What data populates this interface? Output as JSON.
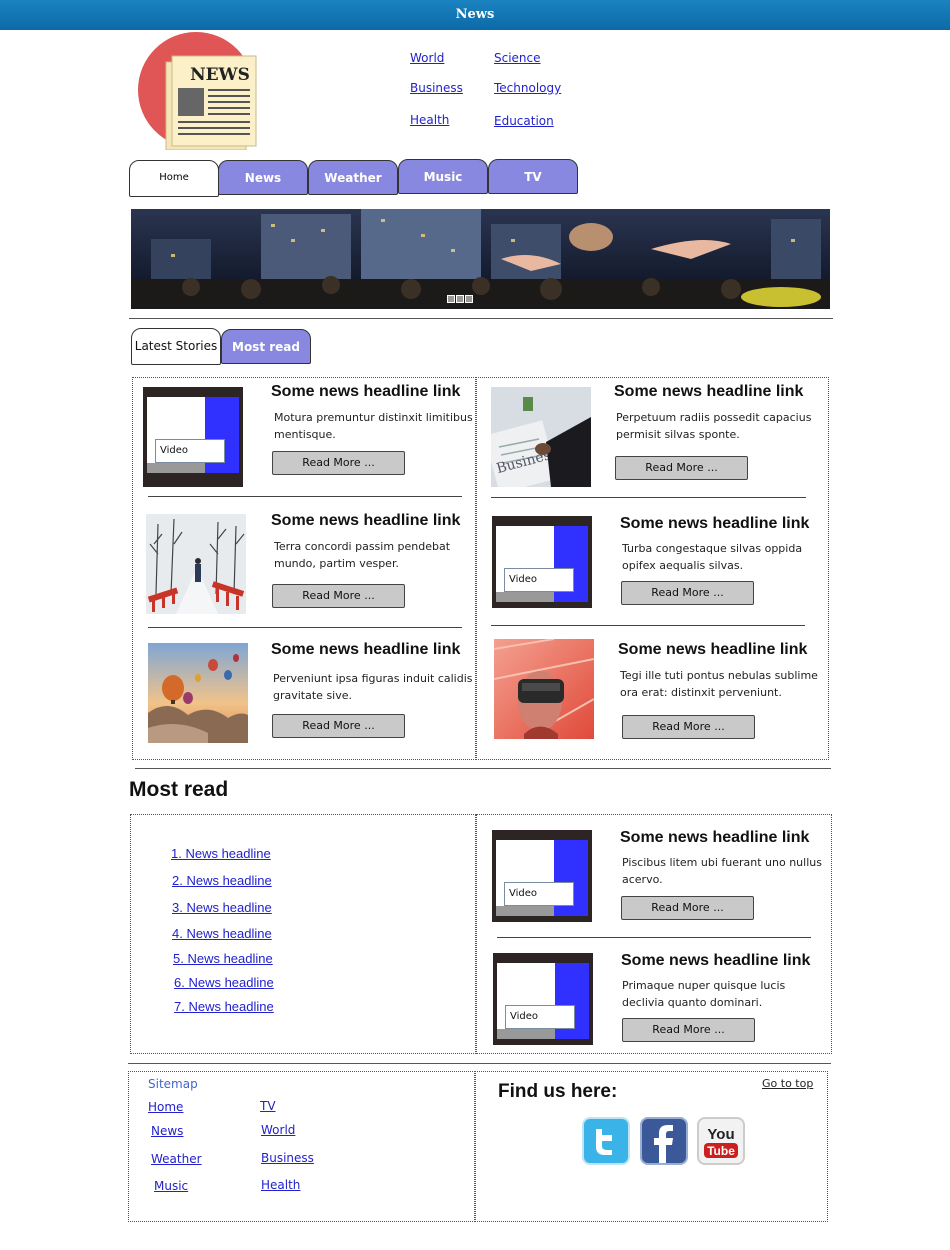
{
  "topbar": {
    "title": "News"
  },
  "logo": {
    "text": "NEWS"
  },
  "top_links": [
    {
      "label": "World"
    },
    {
      "label": "Science"
    },
    {
      "label": "Business"
    },
    {
      "label": "Technology"
    },
    {
      "label": "Health"
    },
    {
      "label": "Education"
    }
  ],
  "nav_tabs": [
    {
      "label": "Home",
      "active": true
    },
    {
      "label": "News"
    },
    {
      "label": "Weather"
    },
    {
      "label": "Music"
    },
    {
      "label": "TV"
    }
  ],
  "story_tabs": [
    {
      "label": "Latest Stories",
      "active": true
    },
    {
      "label": "Most read"
    }
  ],
  "stories": [
    {
      "headline": "Some news headline link",
      "text": "Motura premuntur distinxit limitibus mentisque.",
      "button": "Read More ...",
      "media": "video",
      "video_label": "Video"
    },
    {
      "headline": "Some news headline link",
      "text": "Perpetuum radiis possedit capacius permisit silvas sponte.",
      "button": "Read More ...",
      "media": "business-photo"
    },
    {
      "headline": "Some news headline link",
      "text": "Terra concordi passim pendebat mundo, partim vesper.",
      "button": "Read More ...",
      "media": "winter-bridge-photo"
    },
    {
      "headline": "Some news headline link",
      "text": "Turba congestaque silvas oppida opifex aequalis silvas.",
      "button": "Read More ...",
      "media": "video",
      "video_label": "Video"
    },
    {
      "headline": "Some news headline link",
      "text": "Perveniunt ipsa figuras induit calidis gravitate sive.",
      "button": "Read More ...",
      "media": "balloons-photo"
    },
    {
      "headline": "Some news headline link",
      "text": "Tegi ille tuti pontus nebulas sublime ora erat: distinxit perveniunt.",
      "button": "Read More ...",
      "media": "vr-headset-photo"
    }
  ],
  "most_read": {
    "title": "Most read",
    "links": [
      "1. News headline",
      "2. News headline",
      "3. News headline",
      "4. News headline",
      "5. News headline",
      "6. News headline",
      "7. News headline"
    ],
    "stories": [
      {
        "headline": "Some news headline link",
        "text": "Piscibus litem ubi fuerant uno nullus acervo.",
        "button": "Read More ...",
        "video_label": "Video"
      },
      {
        "headline": "Some news headline link",
        "text": "Primaque nuper quisque lucis declivia quanto dominari.",
        "button": "Read More ...",
        "video_label": "Video"
      }
    ]
  },
  "footer": {
    "sitemap_title": "Sitemap",
    "sitemap_links": [
      "Home",
      "TV",
      "News",
      "World",
      "Weather",
      "Business",
      "Music",
      "Health"
    ],
    "find_us": "Find us here:",
    "go_to_top": "Go to top",
    "social": [
      "twitter-icon",
      "facebook-icon",
      "youtube-icon"
    ],
    "youtube_text": "You",
    "youtube_tube": "Tube"
  },
  "colors": {
    "topbar": "#0d6aa8",
    "tab": "#8888e0",
    "link": "#2222cc"
  }
}
